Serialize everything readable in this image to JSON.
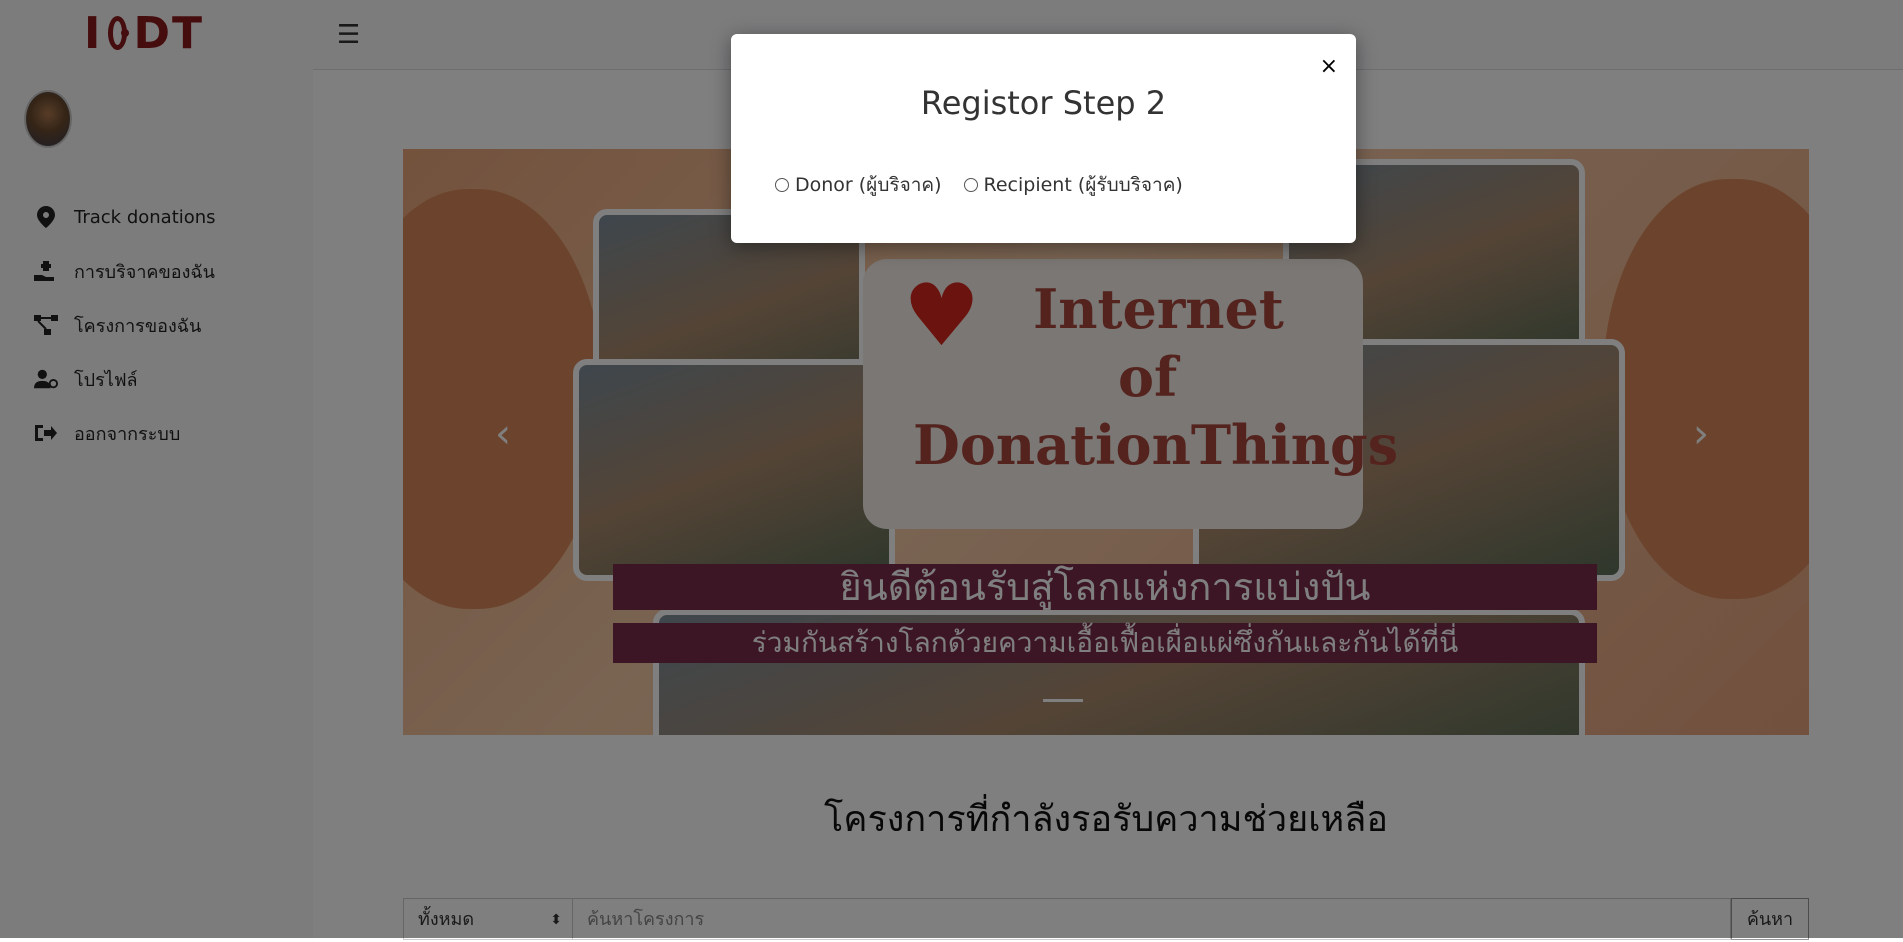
{
  "brand": {
    "logo_text_left": "I",
    "logo_text_right": "DT"
  },
  "sidebar": {
    "items": [
      {
        "label": "Track donations",
        "icon": "map-pin-icon"
      },
      {
        "label": "การบริจาคของฉัน",
        "icon": "hand-holding-icon"
      },
      {
        "label": "โครงการของฉัน",
        "icon": "project-diagram-icon"
      },
      {
        "label": "โปรไฟล์",
        "icon": "user-gear-icon"
      },
      {
        "label": "ออกจากระบบ",
        "icon": "sign-out-icon"
      }
    ]
  },
  "topbar": {
    "menu_icon": "hamburger-icon"
  },
  "carousel": {
    "brand_line1": "Internet",
    "brand_line2": "of",
    "brand_line3": "DonationThings",
    "caption_title": "ยินดีต้อนรับสู่โลกแห่งการแบ่งปัน",
    "caption_subtitle": "ร่วมกันสร้างโลกด้วยความเอื้อเฟื้อเผื่อแผ่ซึ่งกันและกันได้ที่นี่"
  },
  "projects": {
    "title": "โครงการที่กำลังรอรับความช่วยเหลือ",
    "filter_selected": "ทั้งหมด",
    "search_placeholder": "ค้นหาโครงการ",
    "search_button": "ค้นหา"
  },
  "modal": {
    "title": "Registor Step 2",
    "close": "×",
    "options": [
      {
        "label": "Donor (ผู้บริจาค)"
      },
      {
        "label": "Recipient (ผู้รับบริจาค)"
      }
    ]
  },
  "colors": {
    "caption_bg": "#7b2d4a",
    "brand_red": "#8b1a1a",
    "overlay": "rgba(0,0,0,0.5)"
  }
}
